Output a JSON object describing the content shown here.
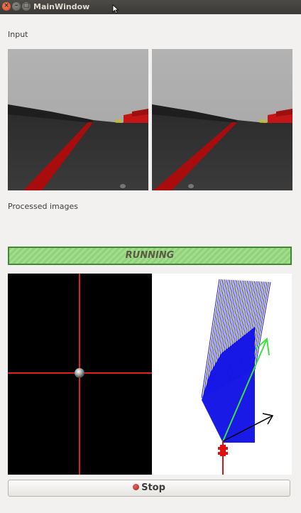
{
  "window": {
    "title": "MainWindow",
    "controls": {
      "close": "×",
      "minimize": "–",
      "maximize": "□"
    }
  },
  "input_section": {
    "label": "Input",
    "images": [
      {
        "name": "left-camera",
        "description_icon": "camera-view"
      },
      {
        "name": "right-camera",
        "description_icon": "camera-view"
      }
    ]
  },
  "processed_section": {
    "label": "Processed images"
  },
  "status": {
    "text": "RUNNING",
    "color": "#8fd27a",
    "border_color": "#3c8a32"
  },
  "stop_button": {
    "label": "Stop",
    "icon": "record-icon"
  },
  "colors": {
    "crosshair": "#e02020",
    "obstacle_fan": "#1414e6",
    "green_vector": "#40e040",
    "black_vector": "#000000",
    "robot": "#e01010"
  }
}
